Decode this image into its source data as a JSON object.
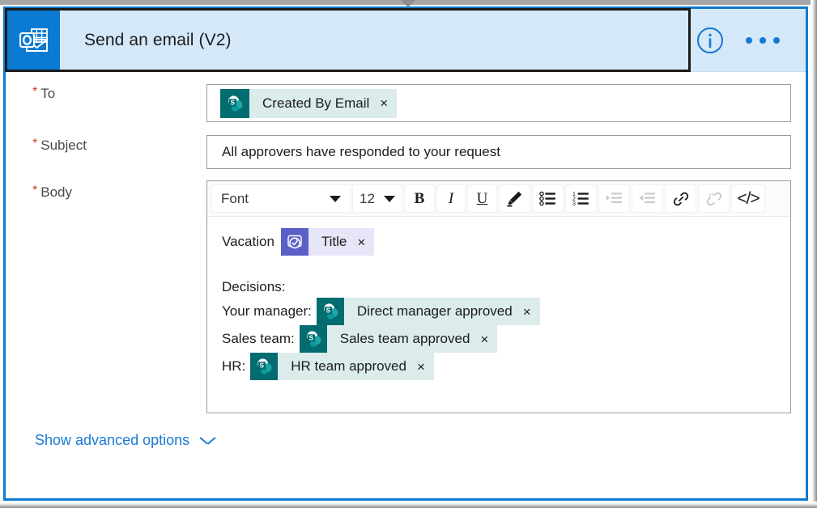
{
  "card": {
    "icon": "outlook-icon",
    "title": "Send an email (V2)",
    "info_icon": "info-circle-icon",
    "more_icon": "more-options-icon"
  },
  "fields": {
    "to": {
      "label": "To",
      "required_marker": "*",
      "tokens": [
        {
          "icon": "sharepoint-icon",
          "label": "Created By Email",
          "remove": "×",
          "kind": "sharepoint"
        }
      ]
    },
    "subject": {
      "label": "Subject",
      "required_marker": "*",
      "value": "All approvers have responded to your request"
    },
    "body": {
      "label": "Body",
      "required_marker": "*"
    }
  },
  "toolbar": {
    "font_name": "Font",
    "font_size": "12",
    "bold": "B",
    "italic": "I",
    "underline": "U",
    "highlight_icon": "highlighter-pen-icon",
    "bulleted_list_icon": "bulleted-list-icon",
    "numbered_list_icon": "numbered-list-icon",
    "indent_icon": "increase-indent-icon",
    "outdent_icon": "decrease-indent-icon",
    "link_icon": "insert-link-icon",
    "unlink_icon": "remove-link-icon",
    "code_view": "</>"
  },
  "editor": {
    "lines": [
      {
        "text": "Vacation",
        "token": {
          "icon": "approvals-icon",
          "label": "Title",
          "remove": "×",
          "kind": "approvals"
        }
      },
      {
        "text": "Decisions:",
        "token": null
      },
      {
        "text": "Your manager:",
        "token": {
          "icon": "sharepoint-icon",
          "label": "Direct manager approved",
          "remove": "×",
          "kind": "sharepoint"
        }
      },
      {
        "text": "Sales team:",
        "token": {
          "icon": "sharepoint-icon",
          "label": "Sales team approved",
          "remove": "×",
          "kind": "sharepoint"
        }
      },
      {
        "text": "HR:",
        "token": {
          "icon": "sharepoint-icon",
          "label": "HR team approved",
          "remove": "×",
          "kind": "sharepoint"
        }
      }
    ]
  },
  "footer": {
    "advanced_options": "Show advanced options",
    "chevron_icon": "chevron-down-icon"
  },
  "colors": {
    "card_border": "#0b7ad0",
    "header_bg": "#d5e8f7",
    "app_icon_bg": "#0a7ad3",
    "accent_link": "#1a7ad4",
    "required_star": "#d6392f",
    "sharepoint_icon_bg": "#036c70",
    "sharepoint_token_bg": "#dbeceb",
    "approvals_icon_bg": "#5b5fc7",
    "approvals_token_bg": "#e6e6f8"
  }
}
